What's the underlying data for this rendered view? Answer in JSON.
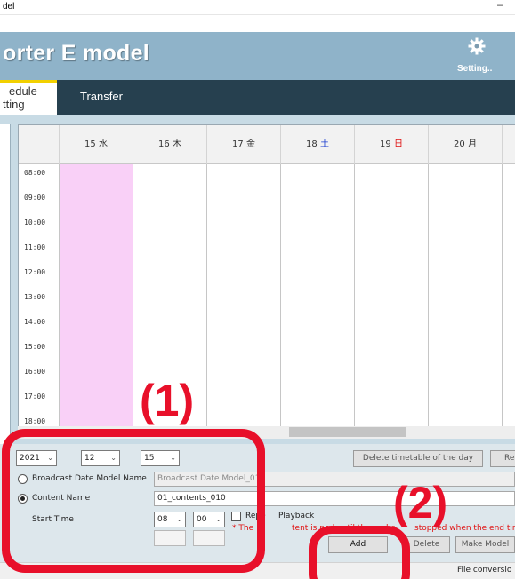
{
  "window": {
    "title_fragment": "del",
    "minimize_glyph": "–"
  },
  "header": {
    "app_title": "orter E model",
    "setting_label": "Setting..",
    "setting_icon": "gear-icon",
    "bg_color": "#8fb3c9"
  },
  "tabs": {
    "schedule_line1": "edule",
    "schedule_line2": "tting",
    "transfer": "Transfer"
  },
  "calendar": {
    "days": [
      {
        "num": "15",
        "dow": "水",
        "color": "#333333"
      },
      {
        "num": "16",
        "dow": "木",
        "color": "#333333"
      },
      {
        "num": "17",
        "dow": "金",
        "color": "#333333"
      },
      {
        "num": "18",
        "dow": "土",
        "color": "#1a3ccf"
      },
      {
        "num": "19",
        "dow": "日",
        "color": "#e01010"
      },
      {
        "num": "20",
        "dow": "月",
        "color": "#333333"
      }
    ],
    "times": [
      "08:00",
      "09:00",
      "10:00",
      "11:00",
      "12:00",
      "13:00",
      "14:00",
      "15:00",
      "16:00",
      "17:00",
      "18:00"
    ],
    "highlight_color": "#f9d0f7"
  },
  "form": {
    "year": "2021",
    "month": "12",
    "day": "15",
    "delete_day_button": "Delete timetable of the day",
    "reload_fragment": "Re",
    "broadcast_radio_label": "Broadcast Date Model Name",
    "broadcast_value": "Broadcast Date Model_01",
    "content_radio_label": "Content Name",
    "content_value": "01_contents_010",
    "start_time_label": "Start Time",
    "hour": "08",
    "minute": "00",
    "time_sep": ":",
    "repeat_label": "Repe",
    "playback_fragment": "Playback",
    "note": "* The",
    "note_rest": "tent is p",
    "note_tail": "ed until the end o",
    "note_end": "stopped when the end tim",
    "add_button": "Add",
    "delete_button": "Delete",
    "make_model_button": "Make Model"
  },
  "status": {
    "text": "File conversio"
  },
  "annotations": {
    "one": "(1)",
    "two": "(2)",
    "color": "#e8102a"
  }
}
